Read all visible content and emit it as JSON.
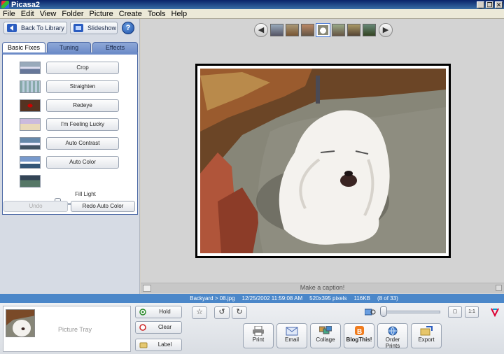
{
  "window": {
    "title": "Picasa2"
  },
  "menu": [
    "File",
    "Edit",
    "View",
    "Folder",
    "Picture",
    "Create",
    "Tools",
    "Help"
  ],
  "toolbar": {
    "back_label": "Back To Library",
    "slideshow_label": "Slideshow",
    "help_label": "?"
  },
  "tabs": [
    {
      "label": "Basic Fixes",
      "active": true
    },
    {
      "label": "Tuning",
      "active": false
    },
    {
      "label": "Effects",
      "active": false
    }
  ],
  "fixes": [
    "Crop",
    "Straighten",
    "Redeye",
    "I'm Feeling Lucky",
    "Auto Contrast",
    "Auto Color"
  ],
  "fill_light": {
    "label": "Fill Light",
    "level": 0
  },
  "history": {
    "undo_label": "Undo",
    "redo_label": "Redo Auto Color"
  },
  "caption": {
    "placeholder": "Make a caption!"
  },
  "status": {
    "path": "Backyard > 08.jpg",
    "date": "12/25/2002 11:59:08 AM",
    "dimensions": "520x395 pixels",
    "size": "116KB",
    "position": "(8 of 33)"
  },
  "tray": {
    "label": "Picture Tray"
  },
  "tray_buttons": {
    "hold": "Hold",
    "clear": "Clear",
    "label": "Label"
  },
  "actions": {
    "print": "Print",
    "email": "Email",
    "collage": "Collage",
    "blog": "BlogThis!",
    "order": "Order Prints",
    "export": "Export"
  },
  "view_buttons": {
    "zoom_1to1": "1:1"
  },
  "colors": {
    "status_bar": "#4b87c9",
    "title_bar": "#0a246a",
    "tab_inactive": "#6d8cc8"
  }
}
